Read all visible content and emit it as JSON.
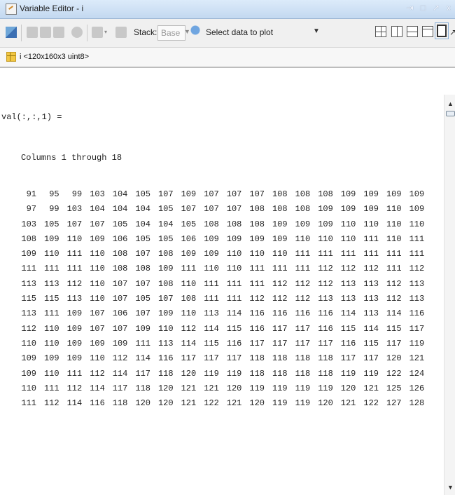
{
  "window": {
    "title": "Variable Editor - i",
    "controls": [
      "⇥",
      "□",
      "↗",
      "x"
    ]
  },
  "toolbar": {
    "stack_label": "Stack:",
    "stack_value": "Base",
    "plot_label": "Select data to plot",
    "undock": "↗",
    "close": "x"
  },
  "tab": {
    "label": "i <120x160x3 uint8>"
  },
  "output": {
    "val_line": "val(:,:,1) =",
    "columns_line": "Columns 1 through 18",
    "rows": [
      [
        91,
        95,
        99,
        103,
        104,
        105,
        107,
        109,
        107,
        107,
        107,
        108,
        108,
        108,
        109,
        109,
        109,
        109
      ],
      [
        97,
        99,
        103,
        104,
        104,
        104,
        105,
        107,
        107,
        107,
        108,
        108,
        108,
        109,
        109,
        109,
        110,
        109
      ],
      [
        103,
        105,
        107,
        107,
        105,
        104,
        104,
        105,
        108,
        108,
        108,
        109,
        109,
        109,
        110,
        110,
        110,
        110
      ],
      [
        108,
        109,
        110,
        109,
        106,
        105,
        105,
        106,
        109,
        109,
        109,
        109,
        110,
        110,
        110,
        111,
        110,
        111
      ],
      [
        109,
        110,
        111,
        110,
        108,
        107,
        108,
        109,
        109,
        110,
        110,
        110,
        111,
        111,
        111,
        111,
        111,
        111
      ],
      [
        111,
        111,
        111,
        110,
        108,
        108,
        109,
        111,
        110,
        110,
        111,
        111,
        111,
        112,
        112,
        112,
        111,
        112
      ],
      [
        113,
        113,
        112,
        110,
        107,
        107,
        108,
        110,
        111,
        111,
        111,
        112,
        112,
        112,
        113,
        113,
        112,
        113
      ],
      [
        115,
        115,
        113,
        110,
        107,
        105,
        107,
        108,
        111,
        111,
        112,
        112,
        112,
        113,
        113,
        113,
        112,
        113
      ],
      [
        113,
        111,
        109,
        107,
        106,
        107,
        109,
        110,
        113,
        114,
        116,
        116,
        116,
        116,
        114,
        113,
        114,
        116
      ],
      [
        112,
        110,
        109,
        107,
        107,
        109,
        110,
        112,
        114,
        115,
        116,
        117,
        117,
        116,
        115,
        114,
        115,
        117
      ],
      [
        110,
        110,
        109,
        109,
        109,
        111,
        113,
        114,
        115,
        116,
        117,
        117,
        117,
        117,
        116,
        115,
        117,
        119
      ],
      [
        109,
        109,
        109,
        110,
        112,
        114,
        116,
        117,
        117,
        117,
        118,
        118,
        118,
        118,
        117,
        117,
        120,
        121
      ],
      [
        109,
        110,
        111,
        112,
        114,
        117,
        118,
        120,
        119,
        119,
        118,
        118,
        118,
        118,
        119,
        119,
        122,
        124
      ],
      [
        110,
        111,
        112,
        114,
        117,
        118,
        120,
        121,
        121,
        120,
        119,
        119,
        119,
        119,
        120,
        121,
        125,
        126
      ],
      [
        111,
        112,
        114,
        116,
        118,
        120,
        120,
        121,
        122,
        121,
        120,
        119,
        119,
        120,
        121,
        122,
        127,
        128
      ]
    ]
  }
}
